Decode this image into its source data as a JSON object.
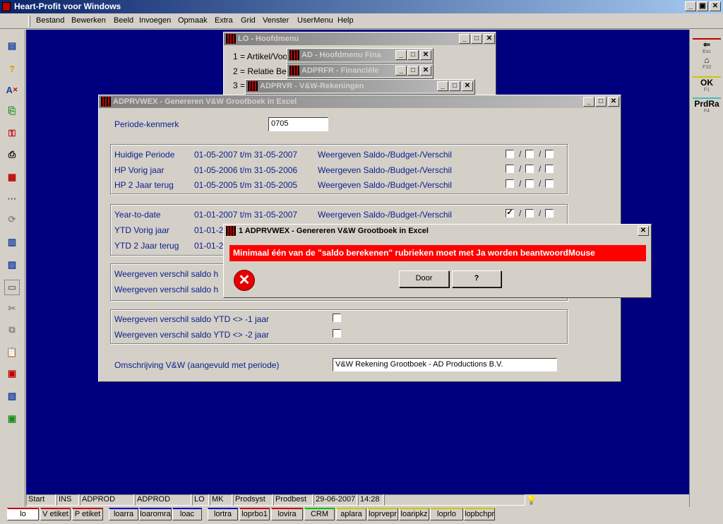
{
  "app": {
    "title": "Heart-Profit voor Windows"
  },
  "menu": [
    "Bestand",
    "Bewerken",
    "Beeld",
    "Invoegen",
    "Opmaak",
    "Extra",
    "Grid",
    "Venster",
    "UserMenu",
    "Help"
  ],
  "right_toolbar": [
    {
      "label": "⇐",
      "key": "Esc"
    },
    {
      "label": "⌂",
      "key": "F10"
    },
    {
      "label": "OK",
      "key": "F1"
    },
    {
      "label": "PrdRa",
      "key": "F4"
    }
  ],
  "windows": {
    "lo": {
      "title": "LO - Hoofdmenu",
      "lines": [
        "1 = Artikel/Voo",
        "2 = Relatie Be",
        "3 ="
      ]
    },
    "ad": {
      "title": "AD - Hoofdmenu Fina"
    },
    "adprfr": {
      "title": "ADPRFR - Financiële"
    },
    "adprvr": {
      "title": "ADPRVR - V&W-Rekeningen"
    }
  },
  "main": {
    "title": "ADPRVWEX - Genereren V&W Grootboek in Excel",
    "periode_label": "Periode-kenmerk",
    "periode_value": "0705",
    "rows": [
      {
        "label": "Huidige Periode",
        "dates": "01-05-2007 t/m 31-05-2007",
        "desc": "Weergeven Saldo-/Budget-/Verschil",
        "checks": [
          false,
          false,
          false
        ]
      },
      {
        "label": "HP Vorig jaar",
        "dates": "01-05-2006 t/m 31-05-2006",
        "desc": "Weergeven Saldo-/Budget-/Verschil",
        "checks": [
          false,
          false,
          false
        ]
      },
      {
        "label": "HP 2 Jaar terug",
        "dates": "01-05-2005 t/m 31-05-2005",
        "desc": "Weergeven Saldo-/Budget-/Verschil",
        "checks": [
          false,
          false,
          false
        ]
      },
      {
        "label": "Year-to-date",
        "dates": "01-01-2007 t/m 31-05-2007",
        "desc": "Weergeven Saldo-/Budget-/Verschil",
        "checks": [
          true,
          false,
          false
        ]
      },
      {
        "label": "YTD Vorig jaar",
        "dates": "01-01-2",
        "desc": "",
        "checks": []
      },
      {
        "label": "YTD 2 Jaar terug",
        "dates": "01-01-2",
        "desc": "",
        "checks": []
      }
    ],
    "verschil": [
      "Weergeven verschil saldo h",
      "Weergeven verschil saldo h"
    ],
    "ytd_verschil": [
      "Weergeven verschil saldo YTD <> -1 jaar",
      "Weergeven verschil saldo YTD <> -2 jaar"
    ],
    "omschrijving_label": "Omschrijving V&W (aangevuld met periode)",
    "omschrijving_value": "V&W Rekening Grootboek - AD Productions B.V."
  },
  "dialog": {
    "title": "1 ADPRVWEX - Genereren V&W Grootboek in Excel",
    "message": "Minimaal één van de \"saldo berekenen\" rubrieken moet met Ja worden beantwoordMouse",
    "door_label": "Door",
    "help_label": "?"
  },
  "status": [
    "Start",
    "INS",
    "ADPROD",
    "ADPROD",
    "LO",
    "MK",
    "Prodsyst",
    "Prodbest",
    "29-06-2007",
    "14:28"
  ],
  "taskbar": [
    "lo",
    "V etiket",
    "P etiket",
    "loarra",
    "loaromra",
    "loac",
    "lortra",
    "loprbo1",
    "lovira",
    "CRM",
    "aplara",
    "loprvepr",
    "loaripkz",
    "loprlo",
    "lopbchpr"
  ]
}
